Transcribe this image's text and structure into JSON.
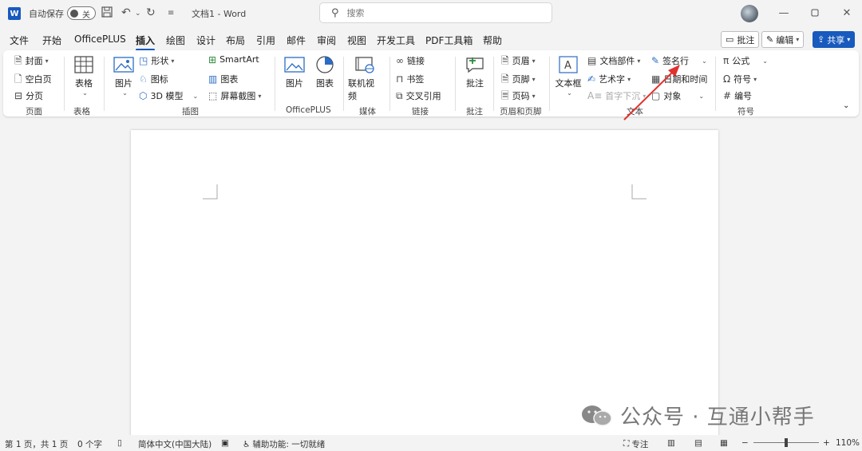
{
  "titlebar": {
    "autosave_label": "自动保存",
    "autosave_state": "关",
    "doc_title": "文档1 - Word",
    "search_placeholder": "搜索"
  },
  "menu": {
    "tabs": [
      "文件",
      "开始",
      "OfficePLUS",
      "插入",
      "绘图",
      "设计",
      "布局",
      "引用",
      "邮件",
      "审阅",
      "视图",
      "开发工具",
      "PDF工具箱",
      "帮助"
    ],
    "active": "插入",
    "comment_btn": "批注",
    "edit_btn": "编辑",
    "share_btn": "共享"
  },
  "ribbon": {
    "pages": {
      "cover": "封面",
      "blank": "空白页",
      "break": "分页",
      "label": "页面"
    },
    "tables": {
      "table": "表格",
      "label": "表格"
    },
    "illustrations": {
      "picture": "图片",
      "shapes": "形状",
      "icons": "图标",
      "model3d": "3D 模型",
      "smartart": "SmartArt",
      "chart": "图表",
      "screenshot": "屏幕截图",
      "label": "插图"
    },
    "officeplus": {
      "picture": "图片",
      "chart": "图表",
      "label": "OfficePLUS"
    },
    "media": {
      "video": "联机视频",
      "label": "媒体"
    },
    "links": {
      "link": "链接",
      "bookmark": "书签",
      "crossref": "交叉引用",
      "label": "链接"
    },
    "comments": {
      "comment": "批注",
      "label": "批注"
    },
    "header_footer": {
      "header": "页眉",
      "footer": "页脚",
      "page_number": "页码",
      "label": "页眉和页脚"
    },
    "text": {
      "textbox": "文本框",
      "quickparts": "文档部件",
      "wordart": "艺术字",
      "dropcap": "首字下沉",
      "signature": "签名行",
      "datetime": "日期和时间",
      "object": "对象",
      "label": "文本"
    },
    "symbols": {
      "equation": "公式",
      "symbol": "符号",
      "number": "编号",
      "label": "符号"
    }
  },
  "watermark": {
    "text": "公众号 · 互通小帮手"
  },
  "status": {
    "page": "第 1 页，共 1 页",
    "words": "0 个字",
    "language": "简体中文(中国大陆)",
    "accessibility": "辅助功能: 一切就绪",
    "focus": "专注",
    "zoom": "110%"
  },
  "colors": {
    "accent": "#185abd",
    "arrow": "#e0322e"
  }
}
